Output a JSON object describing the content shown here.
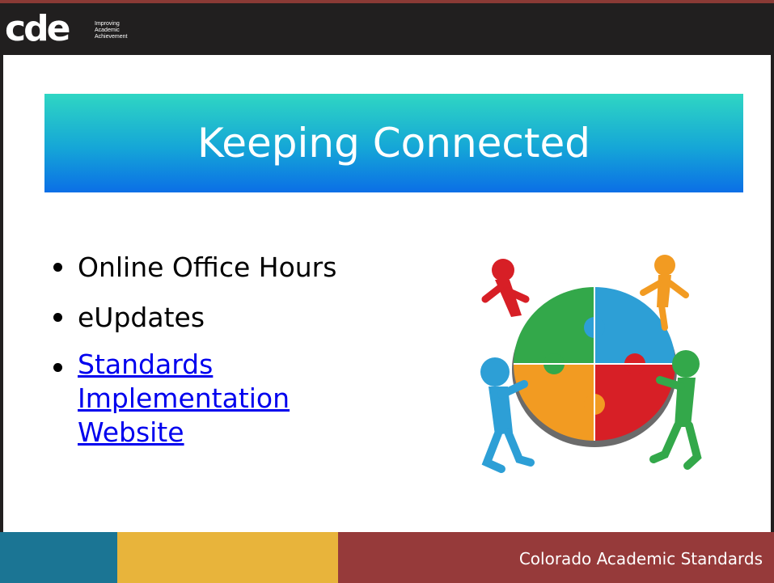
{
  "header": {
    "logo_text": "cde",
    "logo_tagline": "Improving\nAcademic\nAchievement"
  },
  "slide": {
    "title": "Keeping Connected",
    "bullets": [
      {
        "text": "Online Office Hours"
      },
      {
        "text": "eUpdates"
      },
      {
        "link_text": "Standards Implementation Website"
      }
    ]
  },
  "footer": {
    "text": "Colorado Academic Standards",
    "colors": [
      "#1b7594",
      "#e8b43b",
      "#963a3a"
    ]
  },
  "colors": {
    "link": "#0000ee",
    "title_gradient": [
      "#2fd6c3",
      "#15a6d7",
      "#0b6fe6"
    ]
  },
  "illustration": {
    "icon": "puzzle-people-circle",
    "piece_colors": [
      "#33a84a",
      "#2d9fd6",
      "#f29b22",
      "#d71f26"
    ],
    "figure_colors": [
      "#d71f26",
      "#f29b22",
      "#2d9fd6",
      "#33a84a"
    ]
  }
}
